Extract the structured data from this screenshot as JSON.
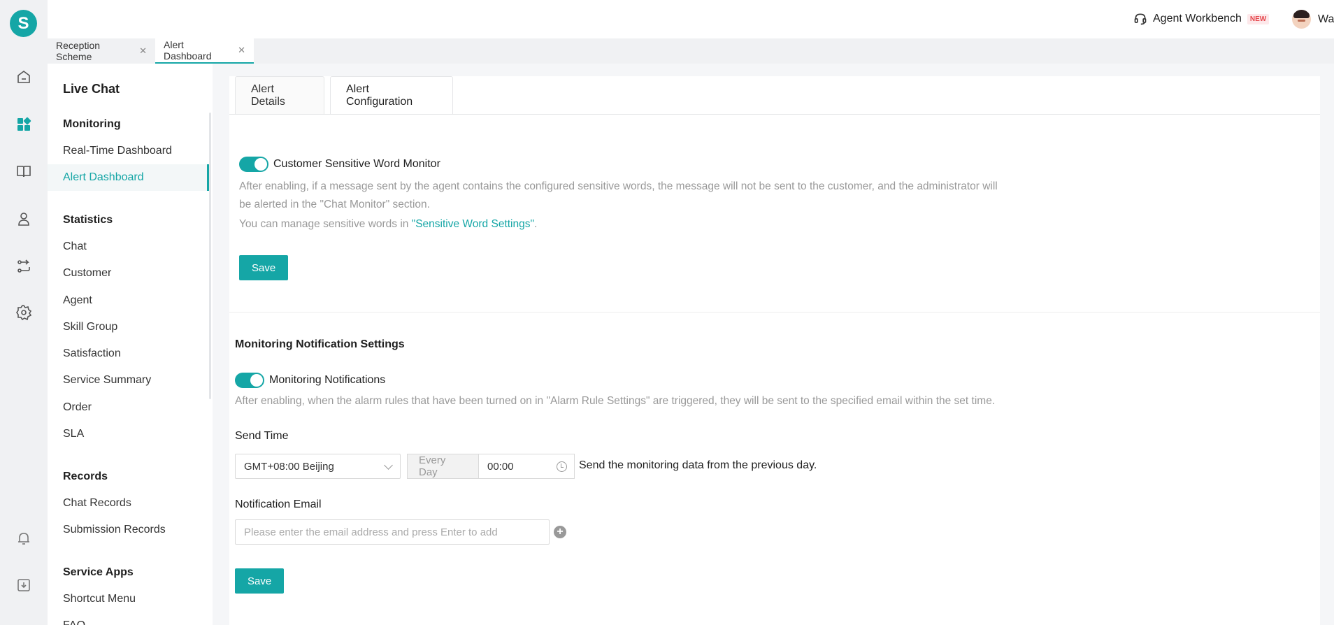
{
  "app": {
    "logo_letter": "S",
    "accent": "#15a6a6"
  },
  "rail": {
    "icons": [
      "home-icon",
      "apps-icon",
      "book-icon",
      "agent-icon",
      "routing-icon",
      "settings-icon",
      "bell-icon",
      "download-icon"
    ]
  },
  "header": {
    "workbench_label": "Agent Workbench",
    "new_badge": "NEW",
    "user_name": "Wang"
  },
  "page_tabs": [
    {
      "label": "Reception Scheme",
      "close": "✕"
    },
    {
      "label": "Alert Dashboard",
      "close": "✕"
    }
  ],
  "sidebar": {
    "title": "Live Chat",
    "groups": [
      {
        "label": "Monitoring",
        "items": [
          "Real-Time Dashboard",
          "Alert Dashboard"
        ]
      },
      {
        "label": "Statistics",
        "items": [
          "Chat",
          "Customer",
          "Agent",
          "Skill Group",
          "Satisfaction",
          "Service Summary",
          "Order",
          "SLA"
        ]
      },
      {
        "label": "Records",
        "items": [
          "Chat Records",
          "Submission Records"
        ]
      },
      {
        "label": "Service Apps",
        "items": [
          "Shortcut Menu",
          "FAQ"
        ]
      }
    ],
    "active_item": "Alert Dashboard"
  },
  "content_tabs": [
    "Alert Details",
    "Alert Configuration"
  ],
  "sensitive": {
    "toggle_label": "Customer Sensitive Word Monitor",
    "desc_line1": "After enabling, if a message sent by the agent contains the configured sensitive words, the message will not be sent to the customer, and the administrator will",
    "desc_line2": "be alerted in the \"Chat Monitor\" section.",
    "manage_prefix": "You can manage sensitive words in ",
    "manage_link": "\"Sensitive Word Settings\"",
    "manage_suffix": ".",
    "save_label": "Save"
  },
  "notification": {
    "section_title": "Monitoring Notification Settings",
    "toggle_label": "Monitoring Notifications",
    "desc": "After enabling, when the alarm rules that have been turned on in \"Alarm Rule Settings\" are triggered, they will be sent to the specified email within the set time.",
    "send_time_label": "Send Time",
    "timezone_value": "GMT+08:00 Beijing",
    "frequency_value": "Every Day",
    "time_value": "00:00",
    "send_note": "Send the monitoring data from the previous day.",
    "email_label": "Notification Email",
    "email_placeholder": "Please enter the email address and press Enter to add",
    "save_label": "Save"
  }
}
